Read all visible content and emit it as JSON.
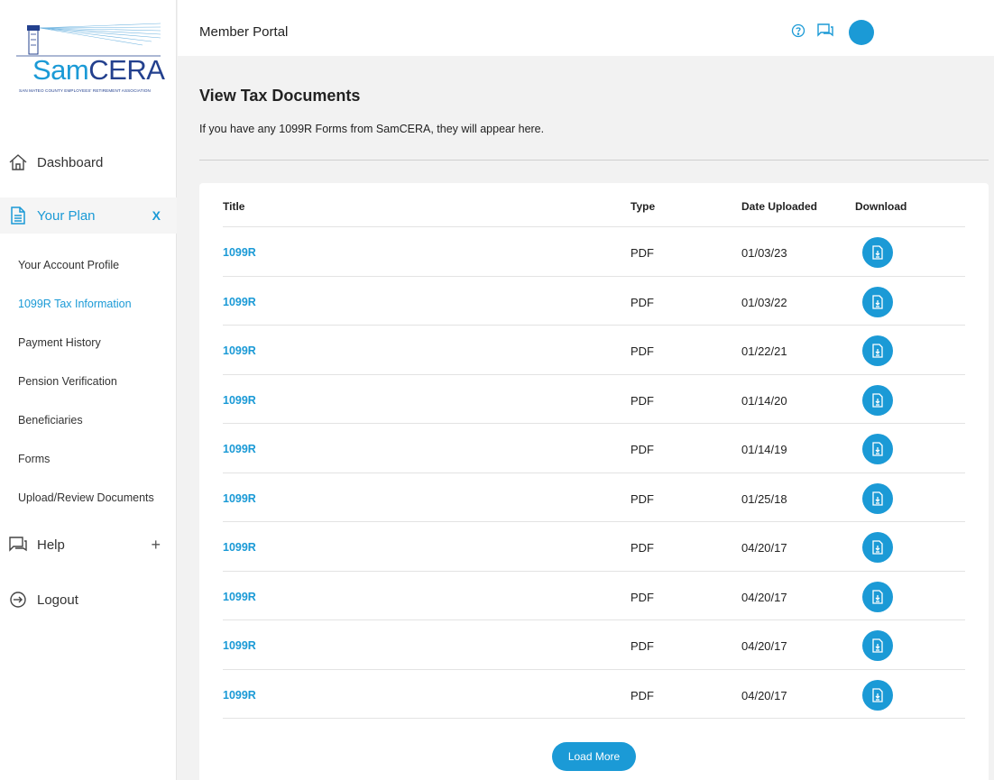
{
  "brand": {
    "logo_part1": "Sam",
    "logo_part2": "CERA",
    "logo_subtitle": "SAN MATEO COUNTY EMPLOYEES' RETIREMENT ASSOCIATION",
    "primary_color": "#1b9ad6",
    "logo_dark_color": "#23408e"
  },
  "header": {
    "title": "Member Portal",
    "icons": [
      "help-circle-icon",
      "chat-icon",
      "user-avatar"
    ]
  },
  "sidebar": {
    "dashboard": {
      "label": "Dashboard",
      "icon": "home-icon"
    },
    "your_plan": {
      "label": "Your Plan",
      "icon": "document-icon",
      "toggle": "X"
    },
    "sub_items": [
      {
        "label": "Your Account Profile"
      },
      {
        "label": "1099R Tax Information"
      },
      {
        "label": "Payment History"
      },
      {
        "label": "Pension Verification"
      },
      {
        "label": "Beneficiaries"
      },
      {
        "label": "Forms"
      },
      {
        "label": "Upload/Review Documents"
      }
    ],
    "help": {
      "label": "Help",
      "icon": "chat-icon",
      "toggle": "+"
    },
    "logout": {
      "label": "Logout",
      "icon": "logout-icon"
    }
  },
  "main": {
    "heading": "View Tax Documents",
    "description": "If you have any 1099R Forms from SamCERA, they will appear here.",
    "table": {
      "headers": {
        "title": "Title",
        "type": "Type",
        "date": "Date Uploaded",
        "download": "Download"
      },
      "rows": [
        {
          "title": "1099R",
          "type": "PDF",
          "date": "01/03/23"
        },
        {
          "title": "1099R",
          "type": "PDF",
          "date": "01/03/22"
        },
        {
          "title": "1099R",
          "type": "PDF",
          "date": "01/22/21"
        },
        {
          "title": "1099R",
          "type": "PDF",
          "date": "01/14/20"
        },
        {
          "title": "1099R",
          "type": "PDF",
          "date": "01/14/19"
        },
        {
          "title": "1099R",
          "type": "PDF",
          "date": "01/25/18"
        },
        {
          "title": "1099R",
          "type": "PDF",
          "date": "04/20/17"
        },
        {
          "title": "1099R",
          "type": "PDF",
          "date": "04/20/17"
        },
        {
          "title": "1099R",
          "type": "PDF",
          "date": "04/20/17"
        },
        {
          "title": "1099R",
          "type": "PDF",
          "date": "04/20/17"
        }
      ]
    },
    "load_more_label": "Load More"
  }
}
